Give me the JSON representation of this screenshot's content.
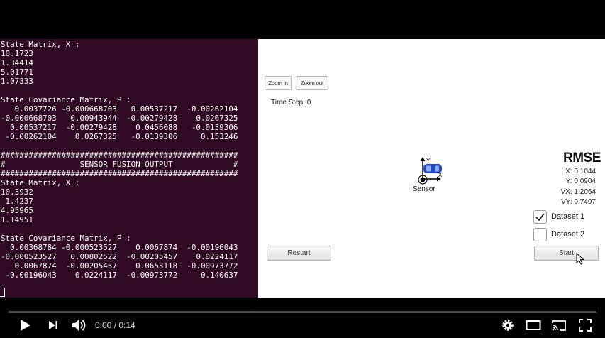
{
  "terminal": {
    "lines": [
      "State Matrix, X :",
      "10.1723",
      "1.34414",
      "5.01771",
      "1.07333",
      "",
      "State Covariance Matrix, P :",
      "   0.0037726 -0.000668703   0.00537217  -0.00262104",
      "-0.000668703   0.00943944  -0.00279428    0.0267325",
      "  0.00537217  -0.00279428    0.0456088   -0.0139306",
      " -0.00262104    0.0267325   -0.0139306     0.153246",
      "",
      "###################################################",
      "#                SENSOR FUSION OUTPUT             #",
      "###################################################",
      "State Matrix, X :",
      "10.3932",
      " 1.4237",
      "4.95965",
      "1.14951",
      "",
      "State Covariance Matrix, P :",
      "  0.00368784 -0.000523527    0.0067874  -0.00196043",
      "-0.000523527   0.00802522  -0.00205457    0.0224117",
      "   0.0067874  -0.00205457    0.0653118  -0.00973772",
      " -0.00196043    0.0224117  -0.00973772     0.140637"
    ]
  },
  "sim": {
    "zoom_in_label": "Zoom in",
    "zoom_out_label": "Zoom out",
    "time_step": "Time Step: 0",
    "sensor_label": "Sensor",
    "axis_y": "Y",
    "axis_x": "X",
    "rmse": {
      "title": "RMSE",
      "x": "X: 0.1044",
      "y": "Y: 0.0904",
      "vx": "VX: 1.2064",
      "vy": "VY: 0.7407"
    },
    "dataset1_label": "Dataset 1",
    "dataset1_checked": true,
    "dataset2_label": "Dataset 2",
    "dataset2_checked": false,
    "restart_label": "Restart",
    "start_label": "Start",
    "car_color": "#2146c7"
  },
  "player": {
    "time": "0:00 / 0:14",
    "progress": 0,
    "icons": [
      "play-icon",
      "next-icon",
      "volume-icon",
      "settings-icon",
      "theater-icon",
      "cast-icon",
      "fullscreen-icon"
    ]
  }
}
